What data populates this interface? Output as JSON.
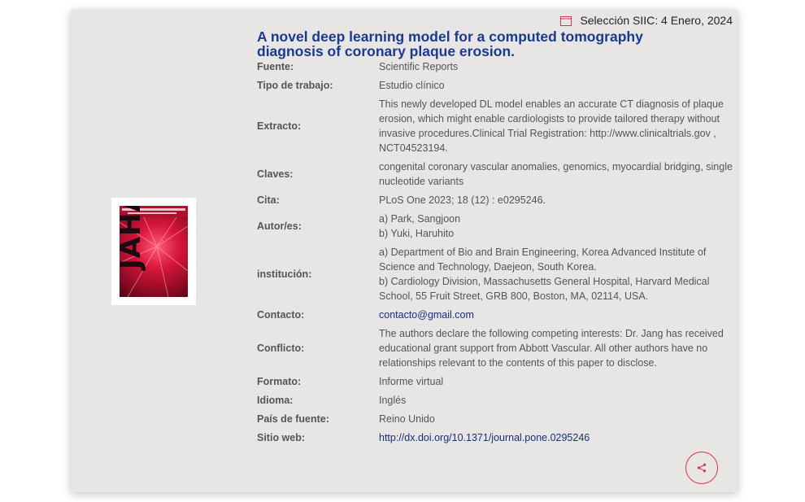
{
  "date_label": "Selección SIIC: 4 Enero, 2024",
  "title": "A novel deep learning model for a computed tomography diagnosis of coronary plaque erosion.",
  "cover": {
    "journal_abbrev": "JAHA"
  },
  "rows": [
    {
      "label": "Fuente:",
      "value": "Scientific Reports"
    },
    {
      "label": "Tipo de trabajo:",
      "value": "Estudio clínico"
    },
    {
      "label": "Extracto:",
      "value": "This newly developed DL model enables an accurate CT diagnosis of plaque erosion, which might enable cardiologists to provide tailored therapy without invasive procedures.Clinical Trial Registration: http://www.clinicaltrials.gov , NCT04523194."
    },
    {
      "label": "Claves:",
      "value": "congenital coronary vascular anomalies, genomics, myocardial bridging, single nucleotide variants"
    },
    {
      "label": "Cita:",
      "value": "PLoS One 2023; 18 (12) : e0295246."
    },
    {
      "label": "Autor/es:",
      "value_lines": [
        "a) Park, Sangjoon",
        "b) Yuki, Haruhito"
      ]
    },
    {
      "label": "institución:",
      "value_lines": [
        "a) Department of Bio and Brain Engineering, Korea Advanced Institute of Science and Technology, Daejeon, South Korea.",
        "b) Cardiology Division, Massachusetts General Hospital, Harvard Medical School, 55 Fruit Street, GRB 800, Boston, MA, 02114, USA."
      ]
    },
    {
      "label": "Contacto:",
      "value": "contacto@gmail.com"
    },
    {
      "label": "Conflicto:",
      "value": "The authors declare the following competing interests: Dr. Jang has received educational grant support from Abbott Vascular. All other authors have no relationships relevant to the contents of this paper to disclose."
    },
    {
      "label": "Formato:",
      "value": "Informe virtual"
    },
    {
      "label": "Idioma:",
      "value": "Inglés"
    },
    {
      "label": "País de fuente:",
      "value": "Reino Unido"
    },
    {
      "label": "Sitio web:",
      "value": "http://dx.doi.org/10.1371/journal.pone.0295246"
    }
  ],
  "icons": {
    "date": "calendar-icon",
    "share": "share-icon"
  },
  "colors": {
    "title": "#1a3a8f",
    "link": "#1a2f7a",
    "accent": "#d9354a",
    "card_bg": "#e8e5e5"
  }
}
